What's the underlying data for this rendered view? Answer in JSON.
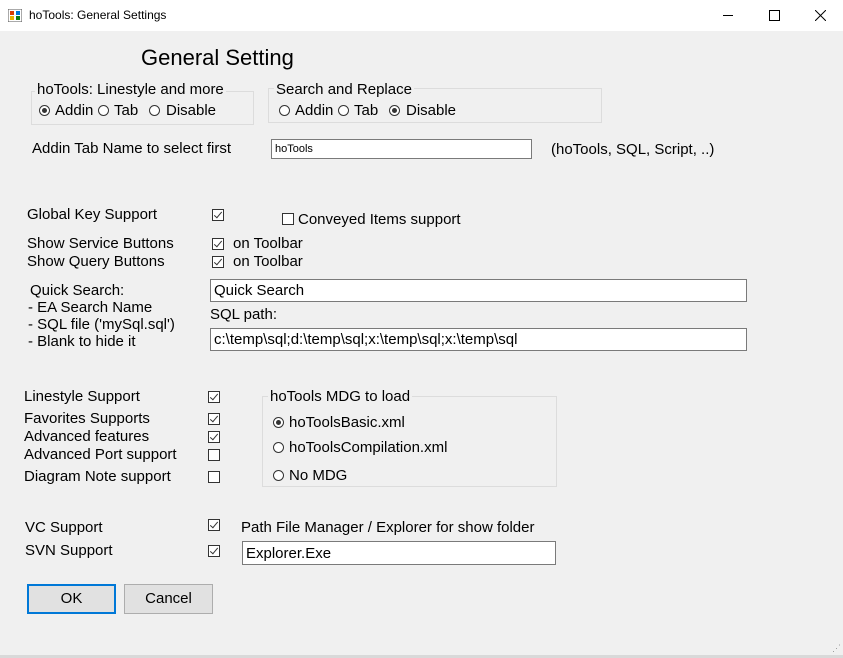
{
  "window": {
    "title": "hoTools: General Settings",
    "icon": "app-icon",
    "controls": [
      "minimize",
      "maximize",
      "close"
    ]
  },
  "heading": "General Setting",
  "linestyle_group": {
    "title": "hoTools: Linestyle and more",
    "options": [
      "Addin",
      "Tab",
      "Disable"
    ],
    "selected": "Addin"
  },
  "search_group": {
    "title": "Search and Replace",
    "options": [
      "Addin",
      "Tab",
      "Disable"
    ],
    "selected": "Disable"
  },
  "addin_tab": {
    "label": "Addin Tab Name to select first",
    "value": "hoTools",
    "hint": "(hoTools, SQL, Script, ..)"
  },
  "global_key": {
    "label": "Global Key Support",
    "checked": true
  },
  "conveyed": {
    "label": "Conveyed Items support",
    "checked": false
  },
  "service_buttons": {
    "label": "Show Service Buttons",
    "checkbox_label": "on Toolbar",
    "checked": true
  },
  "query_buttons": {
    "label": "Show Query Buttons",
    "checkbox_label": "on Toolbar",
    "checked": true
  },
  "quick_search": {
    "label_lines": [
      "Quick  Search:",
      "- EA Search Name",
      "- SQL file ('mySql.sql')",
      "- Blank to hide it"
    ],
    "value": "Quick Search",
    "sql_path_label": "SQL path:",
    "sql_path_value": "c:\\temp\\sql;d:\\temp\\sql;x:\\temp\\sql;x:\\temp\\sql"
  },
  "features": [
    {
      "label": "Linestyle Support",
      "checked": true
    },
    {
      "label": "Favorites Supports",
      "checked": true
    },
    {
      "label": "Advanced features",
      "checked": true
    },
    {
      "label": "Advanced Port support",
      "checked": false
    },
    {
      "label": "Diagram Note support",
      "checked": false
    }
  ],
  "mdg_group": {
    "title": "hoTools MDG to load",
    "options": [
      "hoToolsBasic.xml",
      "hoToolsCompilation.xml",
      "No MDG"
    ],
    "selected": "hoToolsBasic.xml"
  },
  "vc_support": {
    "label": "VC Support",
    "checked": true
  },
  "svn_support": {
    "label": "SVN Support",
    "checked": true
  },
  "file_manager": {
    "label": "Path File Manager / Explorer for show folder",
    "value": "Explorer.Exe"
  },
  "buttons": {
    "ok": "OK",
    "cancel": "Cancel"
  }
}
